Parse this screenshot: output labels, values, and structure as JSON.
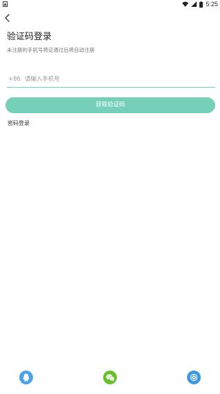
{
  "status_bar": {
    "time": "5:25"
  },
  "header": {
    "back_icon": "chevron-left-icon"
  },
  "login": {
    "title": "验证码登录",
    "subtitle": "未注册的手机号将证通过后将自动注册",
    "country_code": "+86",
    "phone_placeholder": "请输入手机号",
    "phone_value": "",
    "get_code_label": "获取验证码",
    "password_login_label": "密码登录"
  },
  "social_login": {
    "items": [
      {
        "name": "qq",
        "icon": "qq-icon",
        "color": "#4ea1e6"
      },
      {
        "name": "wechat",
        "icon": "wechat-icon",
        "color": "#68c12a"
      },
      {
        "name": "weibo",
        "icon": "weibo-icon",
        "color": "#3e98de"
      }
    ]
  },
  "colors": {
    "accent": "#6fceb4",
    "input_underline": "#6cccb5"
  }
}
